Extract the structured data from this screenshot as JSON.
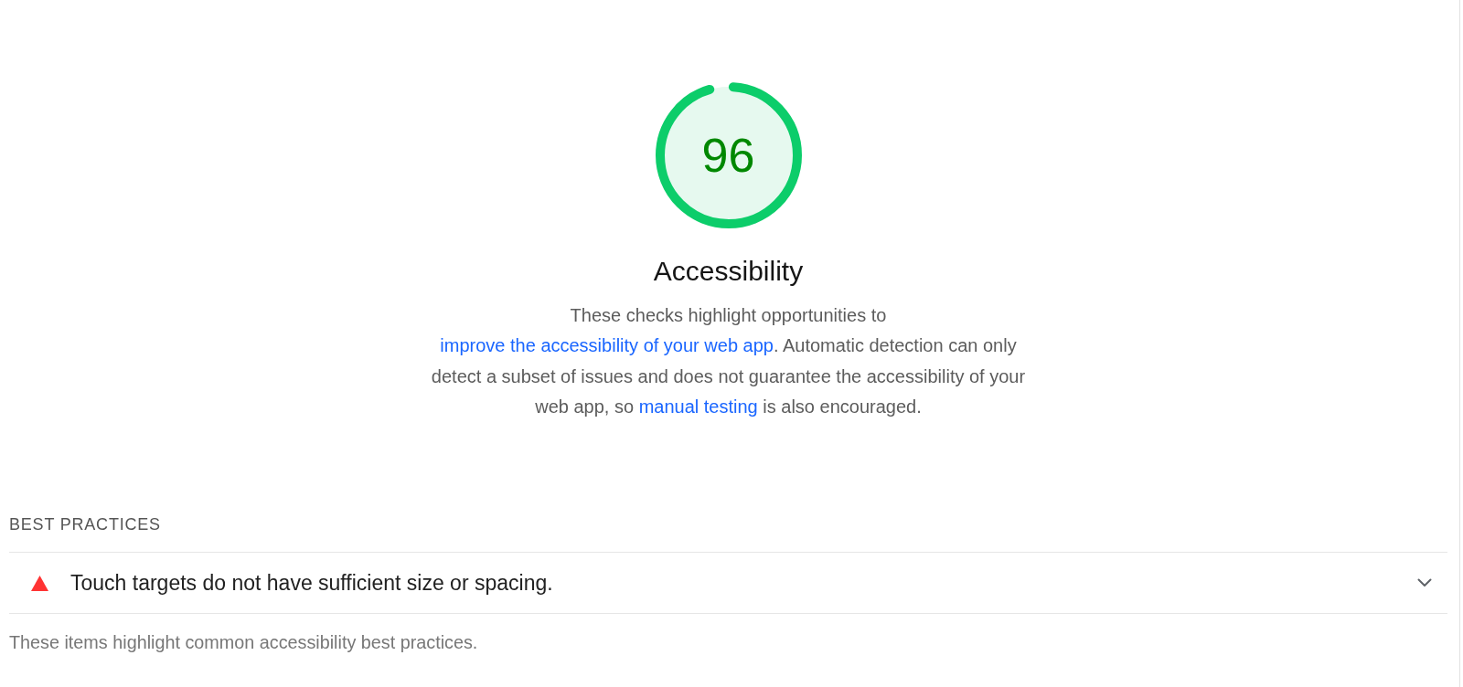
{
  "gauge": {
    "score": "96",
    "level": 0.96
  },
  "category": {
    "title": "Accessibility",
    "description": [
      {
        "kind": "text",
        "text": "These checks highlight opportunities to "
      },
      {
        "kind": "link",
        "text": "improve the accessibility of your web app"
      },
      {
        "kind": "text",
        "text": ". Automatic detection can only detect a subset of issues and does not guarantee the accessibility of your web app, so "
      },
      {
        "kind": "link",
        "text": "manual testing"
      },
      {
        "kind": "text",
        "text": " is also encouraged."
      }
    ]
  },
  "group": {
    "title": "BEST PRACTICES",
    "audits": [
      {
        "title": "Touch targets do not have sufficient size or spacing.",
        "passed": false,
        "expanded": false
      }
    ],
    "description": "These items highlight common accessibility best practices."
  }
}
